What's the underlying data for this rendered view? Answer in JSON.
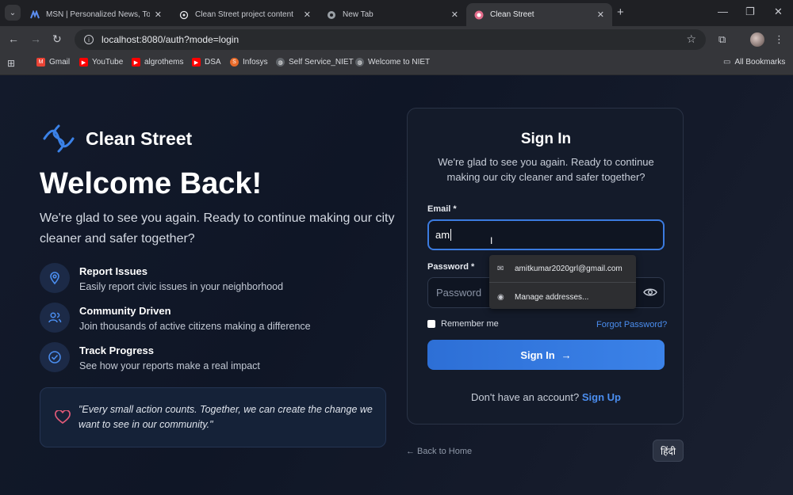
{
  "browser": {
    "tabs": [
      {
        "title": "MSN | Personalized News, Top H",
        "icon": "msn-icon"
      },
      {
        "title": "Clean Street project content",
        "icon": "openai-icon"
      },
      {
        "title": "New Tab",
        "icon": "chrome-icon"
      },
      {
        "title": "Clean Street",
        "icon": "clean-street-favicon"
      }
    ],
    "url": "localhost:8080/auth?mode=login",
    "bookmarks": [
      {
        "label": "Gmail",
        "color": "#ea4335"
      },
      {
        "label": "YouTube",
        "color": "#ff0000"
      },
      {
        "label": "algrothems",
        "color": "#ff0000"
      },
      {
        "label": "DSA",
        "color": "#ff0000"
      },
      {
        "label": "Infosys",
        "color": "#e86b2a"
      },
      {
        "label": "Self Service_NIET",
        "color": "#9aa0a6"
      },
      {
        "label": "Welcome to NIET",
        "color": "#9aa0a6"
      }
    ],
    "all_bookmarks": "All Bookmarks"
  },
  "left": {
    "brand": "Clean Street",
    "heading": "Welcome Back!",
    "subtitle": "We're glad to see you again. Ready to continue making our city cleaner and safer together?",
    "features": [
      {
        "title": "Report Issues",
        "desc": "Easily report civic issues in your neighborhood"
      },
      {
        "title": "Community Driven",
        "desc": "Join thousands of active citizens making a difference"
      },
      {
        "title": "Track Progress",
        "desc": "See how your reports make a real impact"
      }
    ],
    "quote": "\"Every small action counts. Together, we can create the change we want to see in our community.\""
  },
  "form": {
    "title": "Sign In",
    "subtitle": "We're glad to see you again. Ready to continue making our city cleaner and safer together?",
    "email_label": "Email *",
    "email_value": "am",
    "password_label": "Password *",
    "password_placeholder": "Password",
    "remember": "Remember me",
    "forgot": "Forgot Password?",
    "submit": "Sign In",
    "signup_prompt": "Don't have an account?",
    "signup_link": "Sign Up",
    "back": "← Back to Home",
    "lang": "हिंदी"
  },
  "autofill": {
    "suggestion": "amitkumar2020grl@gmail.com",
    "manage": "Manage addresses..."
  },
  "colors": {
    "accent": "#3b82e8",
    "link": "#4b8ef0"
  }
}
